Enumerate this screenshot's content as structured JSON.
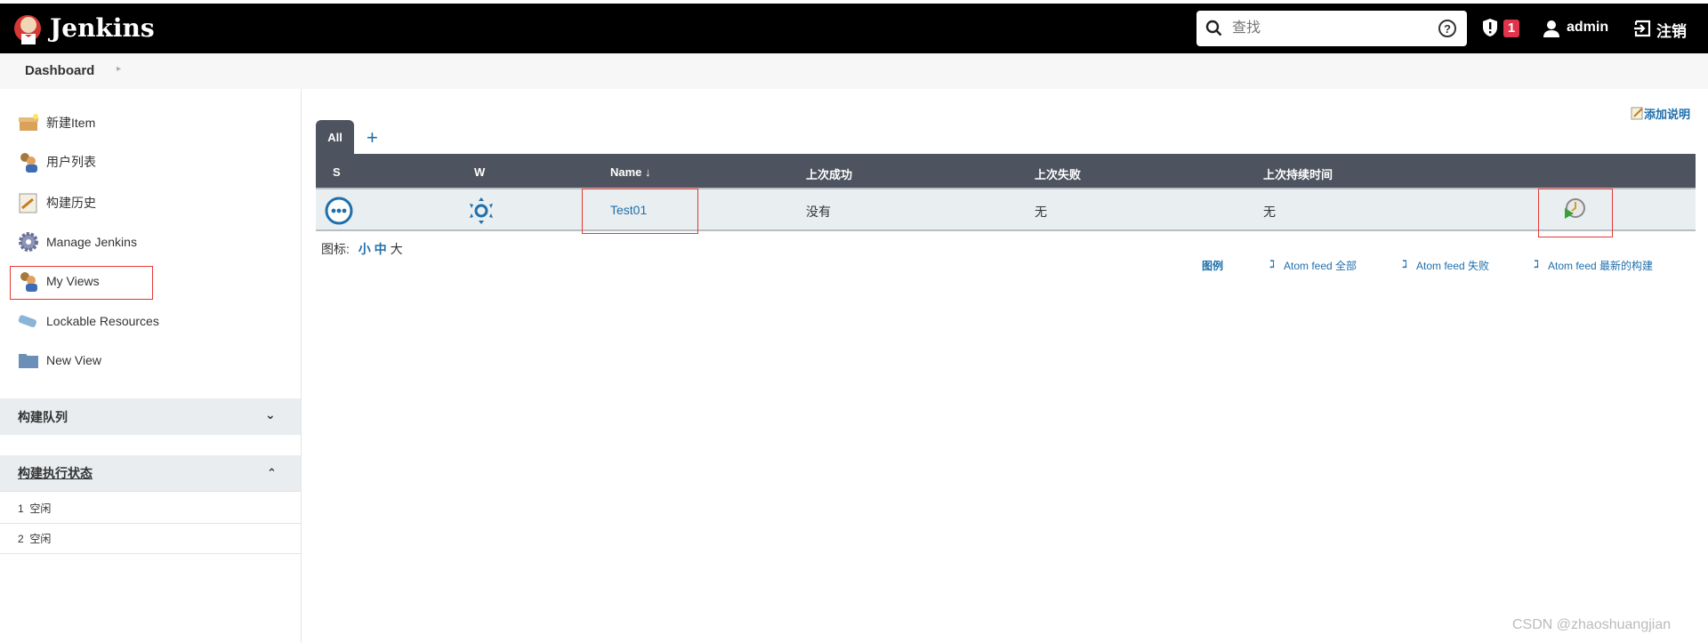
{
  "header": {
    "brand": "Jenkins",
    "search_placeholder": "查找",
    "security_badge": "1",
    "user": "admin",
    "logout": "注销"
  },
  "breadcrumb": {
    "item": "Dashboard"
  },
  "sidebar": {
    "items": [
      {
        "label": "新建Item",
        "icon": "new-item-icon"
      },
      {
        "label": "用户列表",
        "icon": "users-icon"
      },
      {
        "label": "构建历史",
        "icon": "build-history-icon"
      },
      {
        "label": "Manage Jenkins",
        "icon": "gear-icon"
      },
      {
        "label": "My Views",
        "icon": "users-icon"
      },
      {
        "label": "Lockable Resources",
        "icon": "resource-icon"
      },
      {
        "label": "New View",
        "icon": "folder-icon"
      }
    ],
    "build_queue": {
      "title": "构建队列"
    },
    "executors": {
      "title": "构建执行状态",
      "rows": [
        {
          "num": "1",
          "status": "空闲"
        },
        {
          "num": "2",
          "status": "空闲"
        }
      ]
    }
  },
  "main": {
    "add_description": "添加说明",
    "tabs": [
      {
        "label": "All"
      }
    ],
    "add_tab": "+",
    "columns": [
      "S",
      "W",
      "Name ↓",
      "上次成功",
      "上次失败",
      "上次持续时间"
    ],
    "rows": [
      {
        "name": "Test01",
        "last_success": "没有",
        "last_failure": "无",
        "last_duration": "无"
      }
    ],
    "icon_size_label": "图标:",
    "icon_sizes": [
      "小",
      "中",
      "大"
    ],
    "legend": "图例",
    "feeds": [
      "Atom feed 全部",
      "Atom feed 失败",
      "Atom feed 最新的构建"
    ]
  },
  "watermark": "CSDN @zhaoshuangjian"
}
